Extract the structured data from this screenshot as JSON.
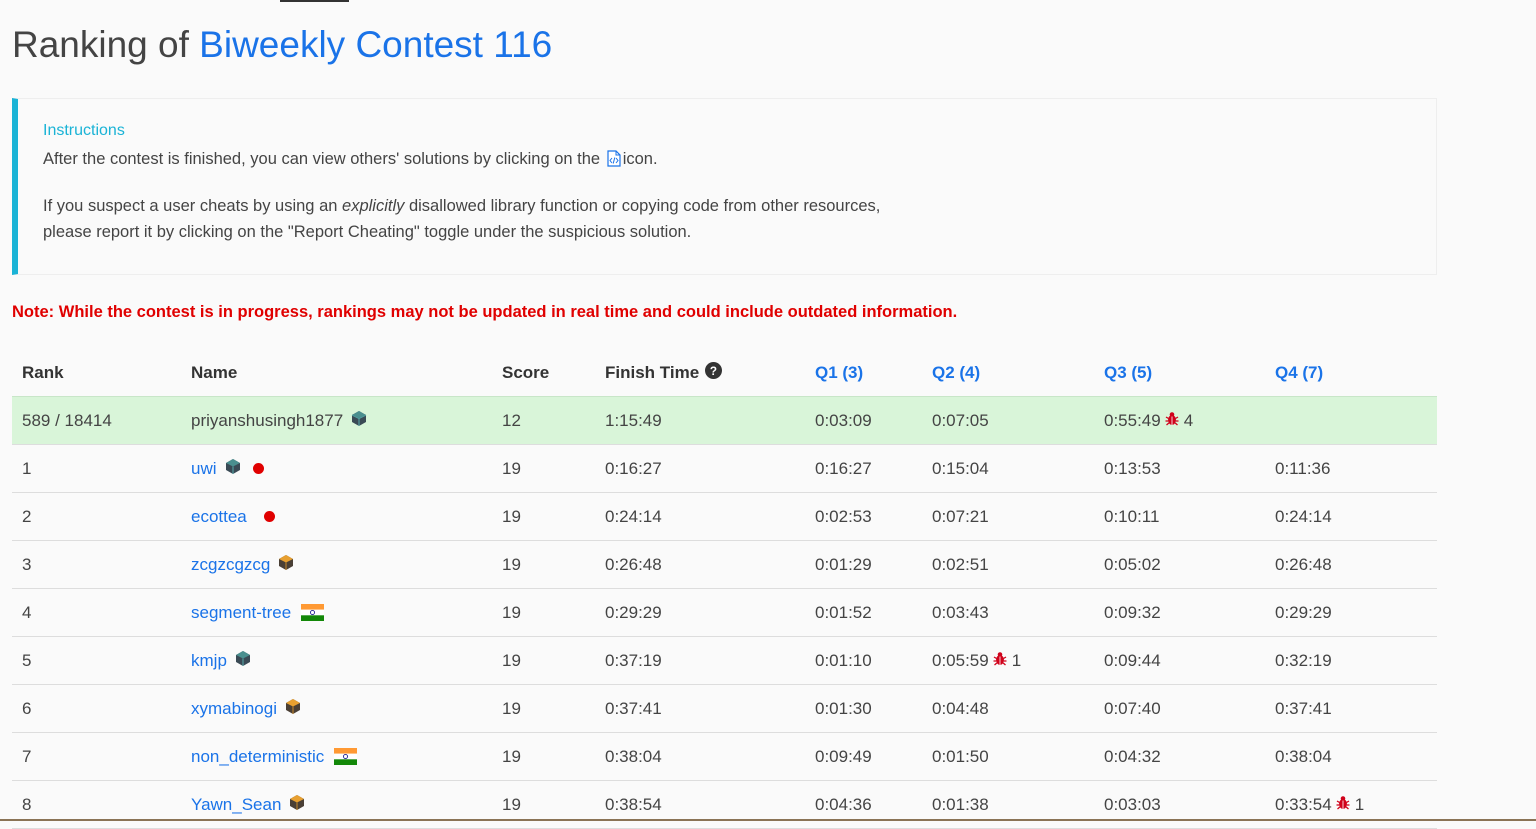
{
  "page": {
    "title_prefix": "Ranking of",
    "contest_name": "Biweekly Contest 116"
  },
  "instructions": {
    "title": "Instructions",
    "line1_before": "After the contest is finished, you can view others' solutions by clicking on the",
    "line1_after": "icon.",
    "line2_before": "If you suspect a user cheats by using an",
    "line2_emph": "explicitly",
    "line2_after": "disallowed library function or copying code from other resources,",
    "line3": "please report it by clicking on the \"Report Cheating\" toggle under the suspicious solution."
  },
  "note": "Note: While the contest is in progress, rankings may not be updated in real time and could include outdated information.",
  "table": {
    "headers": {
      "rank": "Rank",
      "name": "Name",
      "score": "Score",
      "finish": "Finish Time",
      "q1": "Q1 (3)",
      "q2": "Q2 (4)",
      "q3": "Q3 (5)",
      "q4": "Q4 (7)"
    },
    "me": {
      "rank": "589 / 18414",
      "name": "priyanshusingh1877",
      "score": "12",
      "finish": "1:15:49",
      "q1": "0:03:09",
      "q2": "0:07:05",
      "q3": "0:55:49",
      "q3_bugs": "4",
      "q4": ""
    },
    "rows": [
      {
        "rank": "1",
        "name": "uwi",
        "score": "19",
        "finish": "0:16:27",
        "q1": "0:16:27",
        "q2": "0:15:04",
        "q3": "0:13:53",
        "q4": "0:11:36"
      },
      {
        "rank": "2",
        "name": "ecottea",
        "score": "19",
        "finish": "0:24:14",
        "q1": "0:02:53",
        "q2": "0:07:21",
        "q3": "0:10:11",
        "q4": "0:24:14"
      },
      {
        "rank": "3",
        "name": "zcgzcgzcg",
        "score": "19",
        "finish": "0:26:48",
        "q1": "0:01:29",
        "q2": "0:02:51",
        "q3": "0:05:02",
        "q4": "0:26:48"
      },
      {
        "rank": "4",
        "name": "segment-tree",
        "score": "19",
        "finish": "0:29:29",
        "q1": "0:01:52",
        "q2": "0:03:43",
        "q3": "0:09:32",
        "q4": "0:29:29"
      },
      {
        "rank": "5",
        "name": "kmjp",
        "score": "19",
        "finish": "0:37:19",
        "q1": "0:01:10",
        "q2": "0:05:59",
        "q2_bugs": "1",
        "q3": "0:09:44",
        "q4": "0:32:19"
      },
      {
        "rank": "6",
        "name": "xymabinogi",
        "score": "19",
        "finish": "0:37:41",
        "q1": "0:01:30",
        "q2": "0:04:48",
        "q3": "0:07:40",
        "q4": "0:37:41"
      },
      {
        "rank": "7",
        "name": "non_deterministic",
        "score": "19",
        "finish": "0:38:04",
        "q1": "0:09:49",
        "q2": "0:01:50",
        "q3": "0:04:32",
        "q4": "0:38:04"
      },
      {
        "rank": "8",
        "name": "Yawn_Sean",
        "score": "19",
        "finish": "0:38:54",
        "q1": "0:04:36",
        "q2": "0:01:38",
        "q3": "0:03:03",
        "q4": "0:33:54",
        "q4_bugs": "1"
      }
    ]
  },
  "colors": {
    "link": "#1a73e8",
    "accent_cyan": "#1ab3d6",
    "note_red": "#e00000",
    "highlight_row": "#d9f5d9",
    "bug_red": "#d0021b"
  },
  "icons": [
    "code-file-icon",
    "help-circle-icon",
    "cube-badge-icon",
    "japan-flag-icon",
    "india-flag-icon",
    "bug-icon"
  ]
}
